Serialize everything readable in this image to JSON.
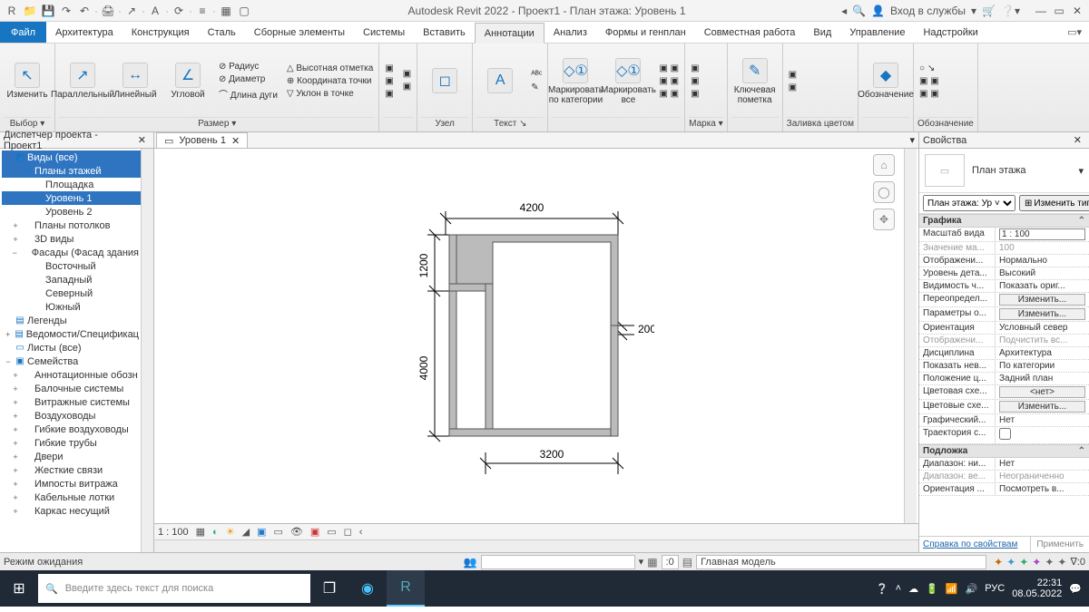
{
  "title": "Autodesk Revit 2022 - Проект1 - План этажа: Уровень 1",
  "qat": [
    "R",
    "📁",
    "💾",
    "↷",
    "↶",
    "·",
    "🖨",
    "·",
    "↗",
    "·",
    "A",
    "·",
    "⟳",
    "·",
    "≡",
    "·",
    "▦",
    "▢"
  ],
  "user": {
    "login": "Вход в службы",
    "cart": "▾"
  },
  "tabs": {
    "file": "Файл",
    "items": [
      "Архитектура",
      "Конструкция",
      "Сталь",
      "Сборные элементы",
      "Системы",
      "Вставить",
      "Аннотации",
      "Анализ",
      "Формы и генплан",
      "Совместная работа",
      "Вид",
      "Управление",
      "Надстройки"
    ],
    "active": 6
  },
  "ribbon": {
    "panels": [
      {
        "label": "Выбор ▾",
        "big": [
          {
            "t": "Изменить",
            "i": "↖"
          }
        ]
      },
      {
        "label": "Размер ▾",
        "big": [
          {
            "t": "Параллельный",
            "i": "↗"
          },
          {
            "t": "Линейный",
            "i": "↔"
          },
          {
            "t": "Угловой",
            "i": "∠"
          }
        ],
        "small": [
          [
            "⊘ Радиус",
            "⊘ Диаметр",
            "⌒ Длина дуги"
          ],
          [
            "△ Высотная отметка",
            "⊕ Координата точки",
            "▽ Уклон  в точке"
          ]
        ]
      },
      {
        "label": "",
        "small": [
          [
            "▣",
            "▣",
            "▣"
          ],
          [
            "▣",
            "▣",
            " "
          ]
        ]
      },
      {
        "label": "Узел",
        "big": [
          {
            "t": "",
            "i": "◻"
          }
        ]
      },
      {
        "label": "Текст ↘",
        "big": [
          {
            "t": "",
            "i": "A"
          }
        ],
        "small": [
          [
            "ᴬᴮᶜ",
            "✎"
          ]
        ]
      },
      {
        "label": "",
        "big": [
          {
            "t": "Маркировать по категории",
            "i": "◇①"
          },
          {
            "t": "Маркировать все",
            "i": "◇①"
          }
        ],
        "small": [
          [
            "▣ ▣",
            "▣ ▣",
            "▣ ▣"
          ]
        ]
      },
      {
        "label": "Марка ▾",
        "small": [
          [
            "▣",
            "▣",
            "▣"
          ]
        ]
      },
      {
        "label": "",
        "big": [
          {
            "t": "Ключевая пометка",
            "i": "✎"
          }
        ]
      },
      {
        "label": "Заливка цветом",
        "small": [
          [
            "▣",
            "▣"
          ]
        ]
      },
      {
        "label": "",
        "big": [
          {
            "t": "Обозначение",
            "i": "◆"
          }
        ]
      },
      {
        "label": "Обозначение",
        "small": [
          [
            "○ ↘",
            "▣ ▣",
            "▣ ▣"
          ]
        ]
      }
    ]
  },
  "browser": {
    "title": "Диспетчер проекта - Проект1",
    "tree": [
      {
        "l": 0,
        "tw": "−",
        "ico": "◩",
        "t": "Виды (все)",
        "sel": true
      },
      {
        "l": 1,
        "tw": "−",
        "ico": "▭",
        "t": "Планы этажей",
        "sel": true
      },
      {
        "l": 2,
        "tw": "",
        "ico": "",
        "t": "Площадка"
      },
      {
        "l": 2,
        "tw": "",
        "ico": "",
        "t": "Уровень 1",
        "sel": true
      },
      {
        "l": 2,
        "tw": "",
        "ico": "",
        "t": "Уровень 2"
      },
      {
        "l": 1,
        "tw": "+",
        "ico": "",
        "t": "Планы потолков"
      },
      {
        "l": 1,
        "tw": "+",
        "ico": "",
        "t": "3D виды"
      },
      {
        "l": 1,
        "tw": "−",
        "ico": "",
        "t": "Фасады (Фасад здания"
      },
      {
        "l": 2,
        "tw": "",
        "ico": "",
        "t": "Восточный"
      },
      {
        "l": 2,
        "tw": "",
        "ico": "",
        "t": "Западный"
      },
      {
        "l": 2,
        "tw": "",
        "ico": "",
        "t": "Северный"
      },
      {
        "l": 2,
        "tw": "",
        "ico": "",
        "t": "Южный"
      },
      {
        "l": 0,
        "tw": "",
        "ico": "▤",
        "t": "Легенды"
      },
      {
        "l": 0,
        "tw": "+",
        "ico": "▤",
        "t": "Ведомости/Спецификац"
      },
      {
        "l": 0,
        "tw": "",
        "ico": "▭",
        "t": "Листы (все)"
      },
      {
        "l": 0,
        "tw": "−",
        "ico": "▣",
        "t": "Семейства"
      },
      {
        "l": 1,
        "tw": "+",
        "ico": "",
        "t": "Аннотационные обозн"
      },
      {
        "l": 1,
        "tw": "+",
        "ico": "",
        "t": "Балочные системы"
      },
      {
        "l": 1,
        "tw": "+",
        "ico": "",
        "t": "Витражные системы"
      },
      {
        "l": 1,
        "tw": "+",
        "ico": "",
        "t": "Воздуховоды"
      },
      {
        "l": 1,
        "tw": "+",
        "ico": "",
        "t": "Гибкие воздуховоды"
      },
      {
        "l": 1,
        "tw": "+",
        "ico": "",
        "t": "Гибкие трубы"
      },
      {
        "l": 1,
        "tw": "+",
        "ico": "",
        "t": "Двери"
      },
      {
        "l": 1,
        "tw": "+",
        "ico": "",
        "t": "Жесткие связи"
      },
      {
        "l": 1,
        "tw": "+",
        "ico": "",
        "t": "Импосты витража"
      },
      {
        "l": 1,
        "tw": "+",
        "ico": "",
        "t": "Кабельные лотки"
      },
      {
        "l": 1,
        "tw": "+",
        "ico": "",
        "t": "Каркас несущий"
      }
    ]
  },
  "viewTab": "Уровень 1",
  "dims": {
    "top": "4200",
    "leftTop": "1200",
    "leftBottom": "4000",
    "bottom": "3200",
    "wall": "200"
  },
  "viewControlScale": "1 : 100",
  "props": {
    "title": "Свойства",
    "type": "План этажа",
    "selector": "План этажа: Ур ˅",
    "editType": "Изменить тип",
    "groups": [
      {
        "name": "Графика",
        "rows": [
          {
            "k": "Масштаб вида",
            "v": "1 : 100",
            "kind": "input"
          },
          {
            "k": "Значение ма...",
            "v": "100",
            "kind": "text",
            "dis": true
          },
          {
            "k": "Отображени...",
            "v": "Нормально",
            "kind": "text"
          },
          {
            "k": "Уровень дета...",
            "v": "Высокий",
            "kind": "text"
          },
          {
            "k": "Видимость ч...",
            "v": "Показать ориг...",
            "kind": "text"
          },
          {
            "k": "Переопредел...",
            "v": "Изменить...",
            "kind": "btn"
          },
          {
            "k": "Параметры о...",
            "v": "Изменить...",
            "kind": "btn"
          },
          {
            "k": "Ориентация",
            "v": "Условный север",
            "kind": "text"
          },
          {
            "k": "Отображени...",
            "v": "Подчистить вс...",
            "kind": "text",
            "dis": true
          },
          {
            "k": "Дисциплина",
            "v": "Архитектура",
            "kind": "text"
          },
          {
            "k": "Показать нев...",
            "v": "По категории",
            "kind": "text"
          },
          {
            "k": "Положение ц...",
            "v": "Задний план",
            "kind": "text"
          },
          {
            "k": "Цветовая схе...",
            "v": "<нет>",
            "kind": "btn"
          },
          {
            "k": "Цветовые схе...",
            "v": "Изменить...",
            "kind": "btn"
          },
          {
            "k": "Графический...",
            "v": "Нет",
            "kind": "text"
          },
          {
            "k": "Траектория с...",
            "v": "",
            "kind": "check"
          }
        ]
      },
      {
        "name": "Подложка",
        "rows": [
          {
            "k": "Диапазон: ни...",
            "v": "Нет",
            "kind": "text"
          },
          {
            "k": "Диапазон: ве...",
            "v": "Неограниченно",
            "kind": "text",
            "dis": true
          },
          {
            "k": "Ориентация ...",
            "v": "Посмотреть в...",
            "kind": "text"
          }
        ]
      }
    ],
    "helpLink": "Справка по свойствам",
    "apply": "Применить"
  },
  "status": {
    "left": "Режим ожидания",
    "sel": ":0",
    "model": "Главная модель",
    "filter": "∇:0"
  },
  "taskbar": {
    "searchPlaceholder": "Введите здесь текст для поиска",
    "lang": "РУС",
    "time": "22:31",
    "date": "08.05.2022"
  }
}
